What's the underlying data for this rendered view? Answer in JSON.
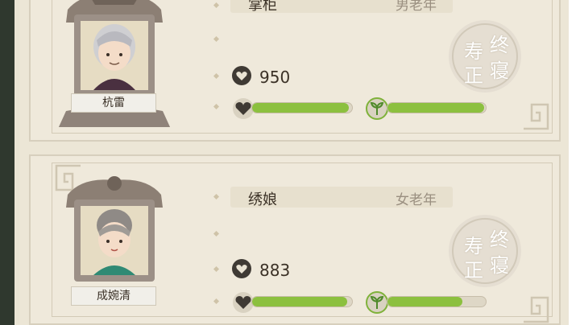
{
  "cards": [
    {
      "name": "杭雷",
      "role_title": "掌柜",
      "role_sub": "男老年",
      "value": "950",
      "health": 0.97,
      "vitality": 0.98,
      "stamp": {
        "line1": "寿",
        "line2": "终",
        "line3": "正",
        "line4": "寝"
      }
    },
    {
      "name": "成婉清",
      "role_title": "绣娘",
      "role_sub": "女老年",
      "value": "883",
      "health": 0.95,
      "vitality": 0.76,
      "stamp": {
        "line1": "寿",
        "line2": "终",
        "line3": "正",
        "line4": "寝"
      }
    }
  ],
  "colors": {
    "bar_fill": "#8cc03f",
    "bar_track": "#ded7c6",
    "card_bg": "#efe9db",
    "rail": "#2f382e"
  },
  "icons": {
    "value": "coin-heart-icon",
    "health": "heart-icon",
    "vitality": "sprout-icon"
  }
}
